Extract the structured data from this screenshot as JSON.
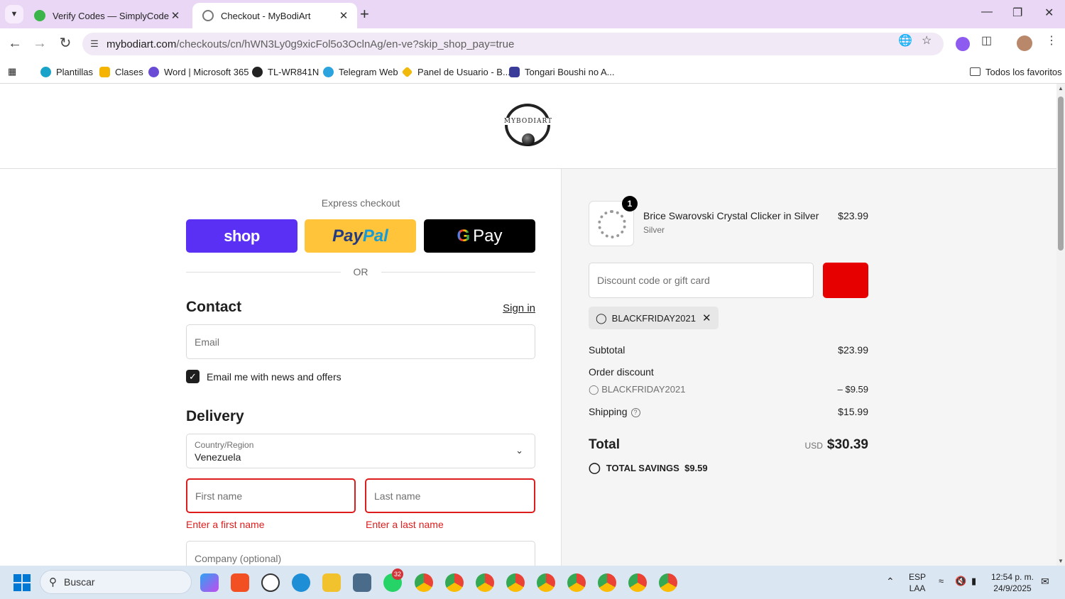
{
  "browser": {
    "tabs": [
      {
        "title": "Verify Codes — SimplyCodes",
        "active": false
      },
      {
        "title": "Checkout - MyBodiArt",
        "active": true
      }
    ],
    "url_host": "mybodiart.com",
    "url_path": "/checkouts/cn/hWN3Ly0g9xicFol5o3OclnAg/en-ve?skip_shop_pay=true",
    "bookmarks": [
      "Plantillas",
      "Clases",
      "Word | Microsoft 365",
      "TL-WR841N",
      "Telegram Web",
      "Panel de Usuario - B...",
      "Tongari Boushi no A..."
    ],
    "all_bookmarks": "Todos los favoritos"
  },
  "store": {
    "logo_text": "MYBODIART"
  },
  "checkout": {
    "express_label": "Express checkout",
    "shop_label": "shop",
    "paypal_pay": "Pay",
    "paypal_pal": "Pal",
    "gpay_g": "G",
    "gpay_label": "Pay",
    "or_label": "OR",
    "contact_heading": "Contact",
    "sign_in": "Sign in",
    "email_placeholder": "Email",
    "newsletter_label": "Email me with news and offers",
    "delivery_heading": "Delivery",
    "country_label": "Country/Region",
    "country_value": "Venezuela",
    "first_name_placeholder": "First name",
    "last_name_placeholder": "Last name",
    "first_name_error": "Enter a first name",
    "last_name_error": "Enter a last name",
    "company_placeholder": "Company (optional)"
  },
  "summary": {
    "item": {
      "name": "Brice Swarovski Crystal Clicker in Silver",
      "variant": "Silver",
      "price": "$23.99",
      "quantity": "1"
    },
    "discount_placeholder": "Discount code or gift card",
    "applied_code": "BLACKFRIDAY2021",
    "subtotal_label": "Subtotal",
    "subtotal_value": "$23.99",
    "order_discount_label": "Order discount",
    "discount_code": "BLACKFRIDAY2021",
    "discount_value": "– $9.59",
    "shipping_label": "Shipping",
    "shipping_value": "$15.99",
    "total_label": "Total",
    "currency": "USD",
    "total_value": "$30.39",
    "savings_label": "TOTAL SAVINGS",
    "savings_value": "$9.59",
    "apply_button_color": "#e70000"
  },
  "taskbar": {
    "search_label": "Buscar",
    "whatsapp_badge": "32",
    "language": "ESP",
    "layout": "LAA",
    "time": "12:54 p. m.",
    "date": "24/9/2025"
  }
}
